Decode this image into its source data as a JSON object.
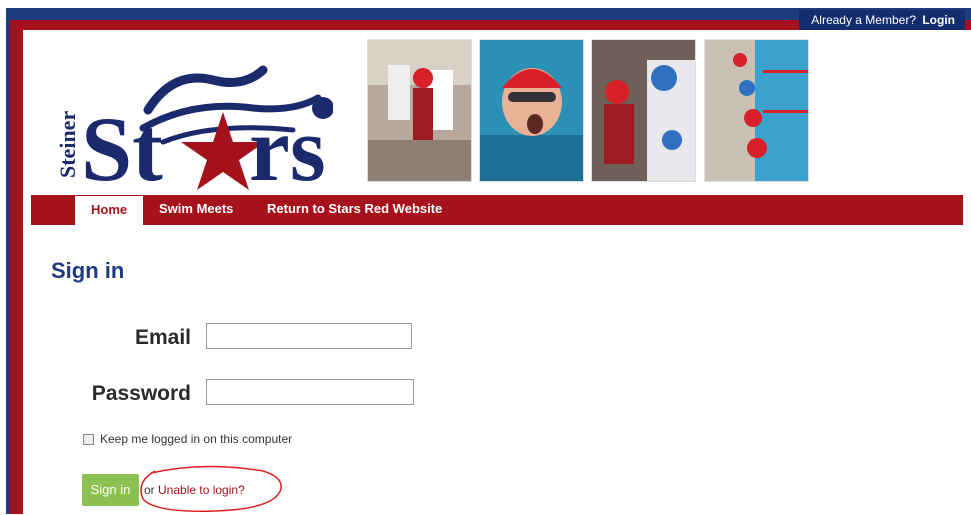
{
  "header": {
    "member_prompt": "Already a Member?",
    "login_label": "Login"
  },
  "logo": {
    "line1": "Steiner",
    "line2": "St",
    "line3": "rs"
  },
  "nav": {
    "items": [
      {
        "label": "Home"
      },
      {
        "label": "Swim Meets"
      },
      {
        "label": "Return to Stars Red Website"
      }
    ]
  },
  "signin": {
    "title": "Sign in",
    "email_label": "Email",
    "email_value": "",
    "password_label": "Password",
    "password_value": "",
    "remember_label": "Keep me logged in on this computer",
    "button_label": "Sign in",
    "or_text": "or",
    "help_link": "Unable to login?"
  },
  "colors": {
    "brand_red": "#a5121c",
    "brand_blue": "#1f3b80",
    "button_green": "#8cc152",
    "annotation_red": "#e02020"
  }
}
